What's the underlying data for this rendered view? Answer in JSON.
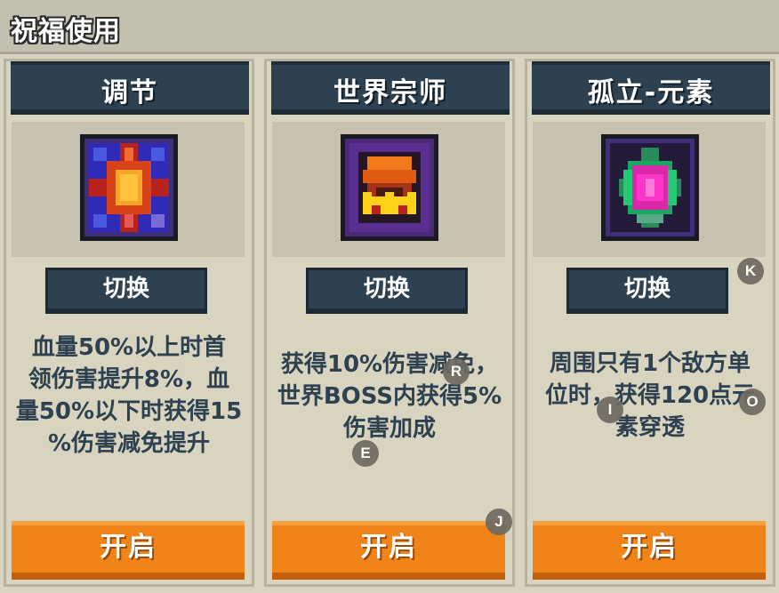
{
  "header": {
    "title": "祝福使用"
  },
  "cards": [
    {
      "title": "调节",
      "icon": "orange-cross-gem-icon",
      "switch_label": "切换",
      "description": [
        "血量50%以上时首",
        "领伤害提升8%，血",
        "量50%以下时获得15",
        "%伤害减免提升"
      ],
      "open_label": "开启"
    },
    {
      "title": "世界宗师",
      "icon": "fire-crown-gem-icon",
      "switch_label": "切换",
      "description": [
        "获得10%伤害减免，",
        "世界BOSS内获得5%",
        "伤害加成"
      ],
      "open_label": "开启"
    },
    {
      "title": "孤立-元素",
      "icon": "pink-green-element-gem-icon",
      "switch_label": "切换",
      "description": [
        "周围只有1个敌方单",
        "位时，获得120点元",
        "素穿透"
      ],
      "open_label": "开启"
    }
  ],
  "markers": [
    "R",
    "E",
    "J",
    "K",
    "I",
    "O"
  ],
  "colors": {
    "panel_dark": "#2d4150",
    "button_orange": "#f08418",
    "background": "#d9d4c0"
  }
}
